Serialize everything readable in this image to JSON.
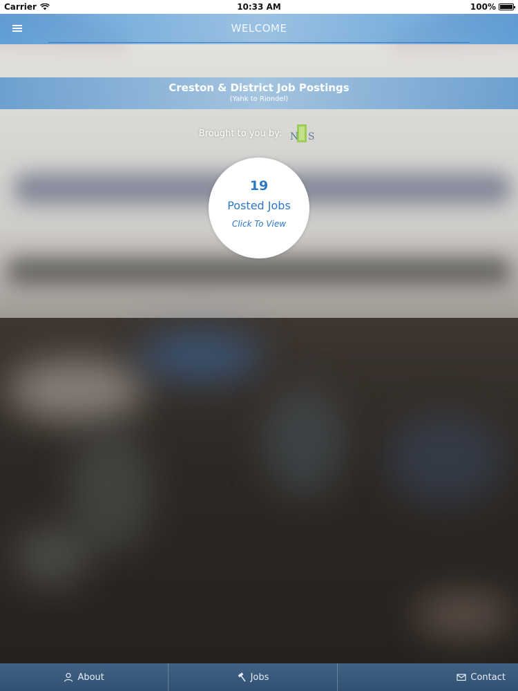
{
  "status_bar": {
    "carrier": "Carrier",
    "time": "10:33 AM",
    "battery_percent": "100%",
    "battery_level": 1.0
  },
  "nav": {
    "title": "WELCOME",
    "menu_icon": "hamburger-menu-icon"
  },
  "banner": {
    "title": "Creston & District Job Postings",
    "subtitle": "(Yahk to Riondel)"
  },
  "sponsor": {
    "label": "Brought to you by:",
    "logo": "sponsor-logo-icon"
  },
  "jobs": {
    "count": "19",
    "label": "Posted Jobs",
    "action": "Click To View"
  },
  "tabs": [
    {
      "label": "About",
      "icon": "person-icon"
    },
    {
      "label": "Jobs",
      "icon": "hammer-icon"
    },
    {
      "label": "Contact",
      "icon": "envelope-icon"
    }
  ],
  "colors": {
    "accent": "#2a78c8",
    "nav_bar": "#4b96d7",
    "tab_bar": "#46698f"
  }
}
